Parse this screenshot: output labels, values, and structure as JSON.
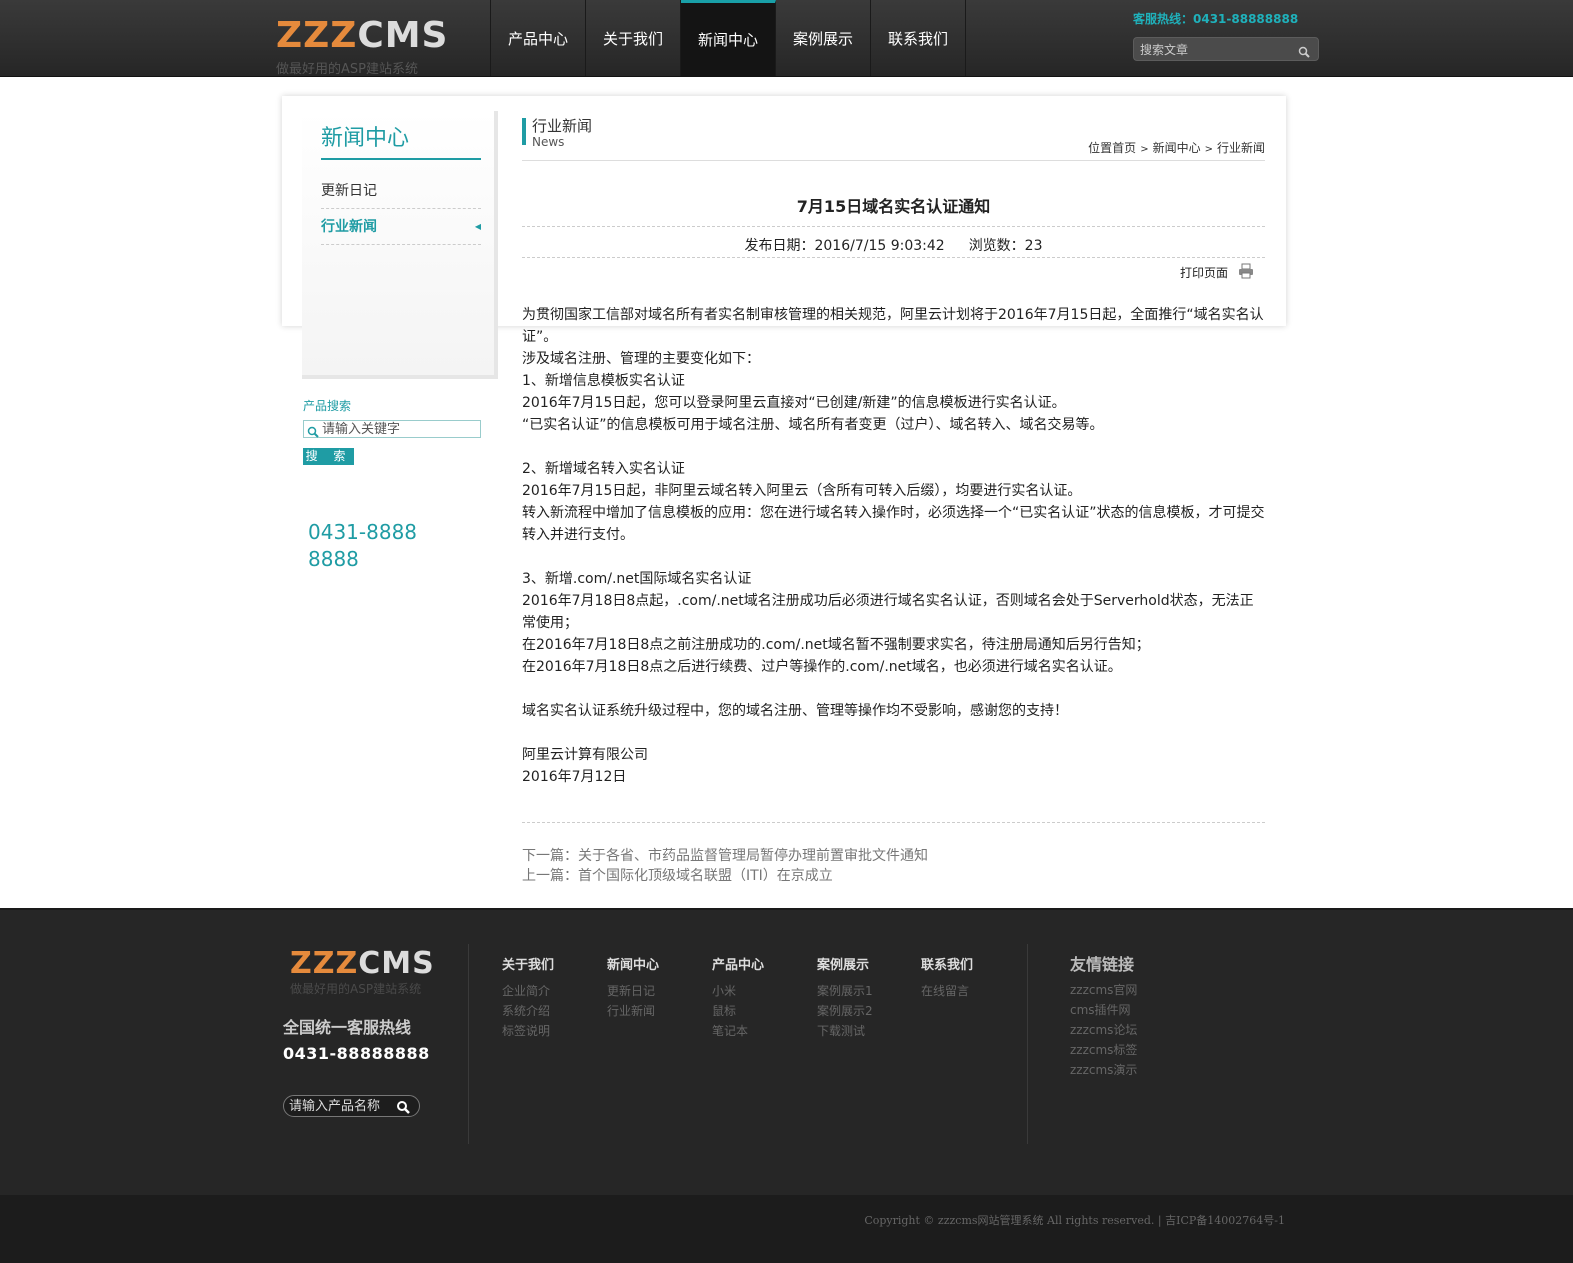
{
  "header": {
    "logo": {
      "main": "ZZZCMS",
      "tagline": "做最好用的ASP建站系统"
    },
    "nav": [
      {
        "label": "产品中心"
      },
      {
        "label": "关于我们"
      },
      {
        "label": "新闻中心",
        "active": true
      },
      {
        "label": "案例展示"
      },
      {
        "label": "联系我们"
      }
    ],
    "hotline": "客服热线：0431-88888888",
    "search_placeholder": "搜索文章"
  },
  "sidebar": {
    "title": "新闻中心",
    "items": [
      {
        "label": "更新日记"
      },
      {
        "label": "行业新闻",
        "active": true
      }
    ],
    "product_search": {
      "label": "产品搜索",
      "placeholder": "请输入关键字",
      "button": "搜 索"
    },
    "phone": "0431-88888888"
  },
  "content": {
    "category": {
      "title": "行业新闻",
      "en": "News"
    },
    "breadcrumb": [
      "位置首页",
      "新闻中心",
      "行业新闻"
    ],
    "article": {
      "title": "7月15日域名实名认证通知",
      "date": "发布日期：2016/7/15 9:03:42",
      "views": "浏览数：23",
      "print": "打印页面",
      "paragraphs": [
        "为贯彻国家工信部对域名所有者实名制审核管理的相关规范，阿里云计划将于2016年7月15日起，全面推行“域名实名认证”。",
        "涉及域名注册、管理的主要变化如下：",
        "1、新增信息模板实名认证",
        "2016年7月15日起，您可以登录阿里云直接对“已创建/新建”的信息模板进行实名认证。",
        "“已实名认证”的信息模板可用于域名注册、域名所有者变更（过户）、域名转入、域名交易等。",
        "",
        "2、新增域名转入实名认证",
        "2016年7月15日起，非阿里云域名转入阿里云（含所有可转入后缀），均要进行实名认证。",
        "转入新流程中增加了信息模板的应用：您在进行域名转入操作时，必须选择一个“已实名认证”状态的信息模板，才可提交转入并进行支付。",
        "",
        "3、新增.com/.net国际域名实名认证",
        "2016年7月18日8点起，.com/.net域名注册成功后必须进行域名实名认证，否则域名会处于Serverhold状态，无法正常使用；",
        "在2016年7月18日8点之前注册成功的.com/.net域名暂不强制要求实名，待注册局通知后另行告知；",
        "在2016年7月18日8点之后进行续费、过户等操作的.com/.net域名，也必须进行域名实名认证。",
        "",
        "域名实名认证系统升级过程中，您的域名注册、管理等操作均不受影响，感谢您的支持！",
        "",
        "阿里云计算有限公司",
        "2016年7月12日"
      ]
    },
    "next": "下一篇：关于各省、市药品监督管理局暂停办理前置审批文件通知",
    "prev": "上一篇：首个国际化顶级域名联盟（ITI）在京成立"
  },
  "footer": {
    "logo": {
      "main": "ZZZCMS",
      "tagline": "做最好用的ASP建站系统"
    },
    "hotline_title": "全国统一客服热线",
    "hotline_number": "0431-88888888",
    "search_placeholder": "请输入产品名称",
    "columns": [
      {
        "title": "关于我们",
        "links": [
          "企业简介",
          "系统介绍",
          "标签说明"
        ]
      },
      {
        "title": "新闻中心",
        "links": [
          "更新日记",
          "行业新闻"
        ]
      },
      {
        "title": "产品中心",
        "links": [
          "小米",
          "鼠标",
          "笔记本"
        ]
      },
      {
        "title": "案例展示",
        "links": [
          "案例展示1",
          "案例展示2",
          "下载测试"
        ]
      },
      {
        "title": "联系我们",
        "links": [
          "在线留言"
        ]
      }
    ],
    "friend_links_title": "友情链接",
    "friend_links": [
      "zzzcms官网",
      "cms插件网",
      "zzzcms论坛",
      "zzzcms标签",
      "zzzcms演示"
    ],
    "copyright": "Copyright © zzzcms网站管理系统 All rights reserved. | 吉ICP备14002764号-1"
  },
  "colors": {
    "accent": "#1f9ca4",
    "logo_orange": "#e58a3c",
    "header_bg": "#2e2e2e",
    "footer_bg": "#262626"
  }
}
